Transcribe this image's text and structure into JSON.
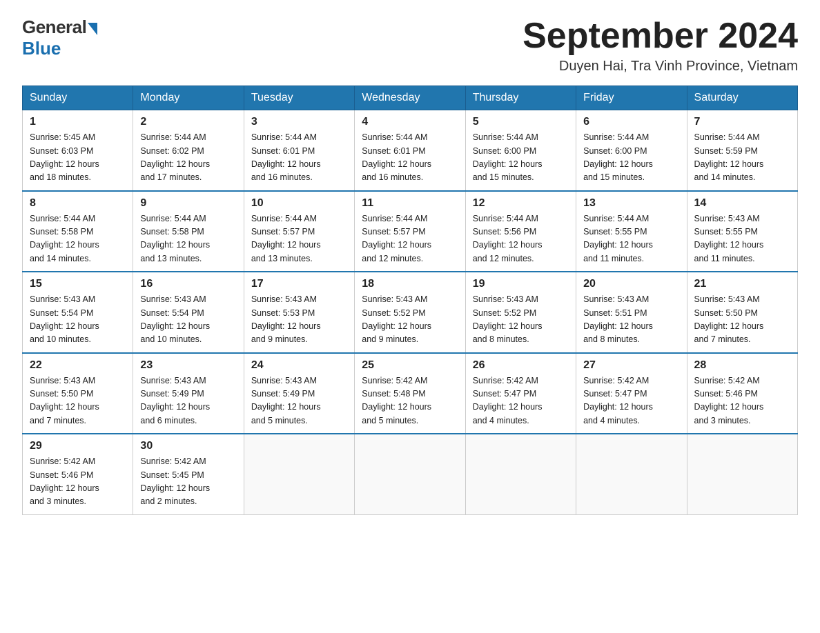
{
  "logo": {
    "general": "General",
    "blue": "Blue"
  },
  "title": "September 2024",
  "location": "Duyen Hai, Tra Vinh Province, Vietnam",
  "headers": [
    "Sunday",
    "Monday",
    "Tuesday",
    "Wednesday",
    "Thursday",
    "Friday",
    "Saturday"
  ],
  "weeks": [
    [
      {
        "day": "1",
        "sunrise": "5:45 AM",
        "sunset": "6:03 PM",
        "daylight": "12 hours and 18 minutes."
      },
      {
        "day": "2",
        "sunrise": "5:44 AM",
        "sunset": "6:02 PM",
        "daylight": "12 hours and 17 minutes."
      },
      {
        "day": "3",
        "sunrise": "5:44 AM",
        "sunset": "6:01 PM",
        "daylight": "12 hours and 16 minutes."
      },
      {
        "day": "4",
        "sunrise": "5:44 AM",
        "sunset": "6:01 PM",
        "daylight": "12 hours and 16 minutes."
      },
      {
        "day": "5",
        "sunrise": "5:44 AM",
        "sunset": "6:00 PM",
        "daylight": "12 hours and 15 minutes."
      },
      {
        "day": "6",
        "sunrise": "5:44 AM",
        "sunset": "6:00 PM",
        "daylight": "12 hours and 15 minutes."
      },
      {
        "day": "7",
        "sunrise": "5:44 AM",
        "sunset": "5:59 PM",
        "daylight": "12 hours and 14 minutes."
      }
    ],
    [
      {
        "day": "8",
        "sunrise": "5:44 AM",
        "sunset": "5:58 PM",
        "daylight": "12 hours and 14 minutes."
      },
      {
        "day": "9",
        "sunrise": "5:44 AM",
        "sunset": "5:58 PM",
        "daylight": "12 hours and 13 minutes."
      },
      {
        "day": "10",
        "sunrise": "5:44 AM",
        "sunset": "5:57 PM",
        "daylight": "12 hours and 13 minutes."
      },
      {
        "day": "11",
        "sunrise": "5:44 AM",
        "sunset": "5:57 PM",
        "daylight": "12 hours and 12 minutes."
      },
      {
        "day": "12",
        "sunrise": "5:44 AM",
        "sunset": "5:56 PM",
        "daylight": "12 hours and 12 minutes."
      },
      {
        "day": "13",
        "sunrise": "5:44 AM",
        "sunset": "5:55 PM",
        "daylight": "12 hours and 11 minutes."
      },
      {
        "day": "14",
        "sunrise": "5:43 AM",
        "sunset": "5:55 PM",
        "daylight": "12 hours and 11 minutes."
      }
    ],
    [
      {
        "day": "15",
        "sunrise": "5:43 AM",
        "sunset": "5:54 PM",
        "daylight": "12 hours and 10 minutes."
      },
      {
        "day": "16",
        "sunrise": "5:43 AM",
        "sunset": "5:54 PM",
        "daylight": "12 hours and 10 minutes."
      },
      {
        "day": "17",
        "sunrise": "5:43 AM",
        "sunset": "5:53 PM",
        "daylight": "12 hours and 9 minutes."
      },
      {
        "day": "18",
        "sunrise": "5:43 AM",
        "sunset": "5:52 PM",
        "daylight": "12 hours and 9 minutes."
      },
      {
        "day": "19",
        "sunrise": "5:43 AM",
        "sunset": "5:52 PM",
        "daylight": "12 hours and 8 minutes."
      },
      {
        "day": "20",
        "sunrise": "5:43 AM",
        "sunset": "5:51 PM",
        "daylight": "12 hours and 8 minutes."
      },
      {
        "day": "21",
        "sunrise": "5:43 AM",
        "sunset": "5:50 PM",
        "daylight": "12 hours and 7 minutes."
      }
    ],
    [
      {
        "day": "22",
        "sunrise": "5:43 AM",
        "sunset": "5:50 PM",
        "daylight": "12 hours and 7 minutes."
      },
      {
        "day": "23",
        "sunrise": "5:43 AM",
        "sunset": "5:49 PM",
        "daylight": "12 hours and 6 minutes."
      },
      {
        "day": "24",
        "sunrise": "5:43 AM",
        "sunset": "5:49 PM",
        "daylight": "12 hours and 5 minutes."
      },
      {
        "day": "25",
        "sunrise": "5:42 AM",
        "sunset": "5:48 PM",
        "daylight": "12 hours and 5 minutes."
      },
      {
        "day": "26",
        "sunrise": "5:42 AM",
        "sunset": "5:47 PM",
        "daylight": "12 hours and 4 minutes."
      },
      {
        "day": "27",
        "sunrise": "5:42 AM",
        "sunset": "5:47 PM",
        "daylight": "12 hours and 4 minutes."
      },
      {
        "day": "28",
        "sunrise": "5:42 AM",
        "sunset": "5:46 PM",
        "daylight": "12 hours and 3 minutes."
      }
    ],
    [
      {
        "day": "29",
        "sunrise": "5:42 AM",
        "sunset": "5:46 PM",
        "daylight": "12 hours and 3 minutes."
      },
      {
        "day": "30",
        "sunrise": "5:42 AM",
        "sunset": "5:45 PM",
        "daylight": "12 hours and 2 minutes."
      },
      null,
      null,
      null,
      null,
      null
    ]
  ]
}
